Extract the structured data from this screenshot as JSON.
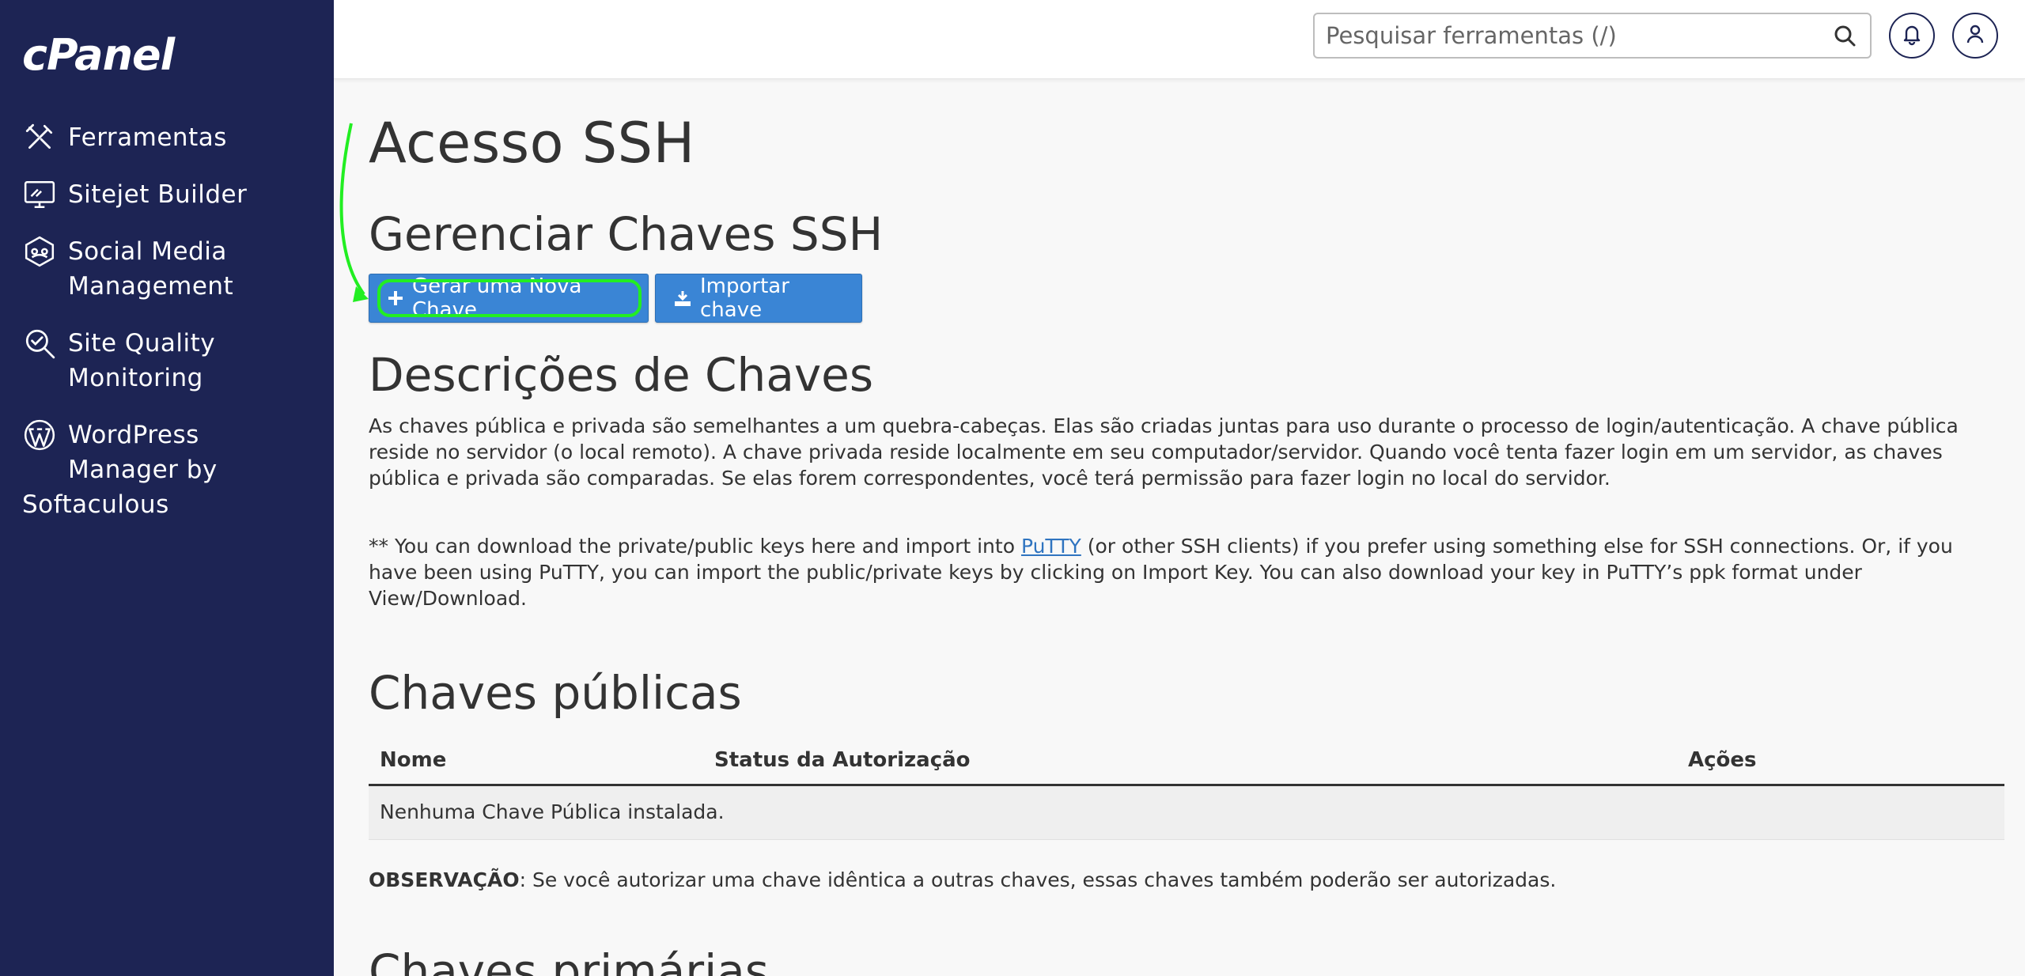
{
  "sidebar": {
    "logo": "cPanel",
    "items": [
      {
        "label": "Ferramentas"
      },
      {
        "label": "Sitejet Builder"
      },
      {
        "label": "Social Media\nManagement"
      },
      {
        "label": "Site Quality\nMonitoring"
      },
      {
        "label": "WordPress\nManager by"
      },
      {
        "label": "Softaculous"
      }
    ]
  },
  "header": {
    "search_placeholder": "Pesquisar ferramentas (/)"
  },
  "main": {
    "title": "Acesso SSH",
    "manage_heading": "Gerenciar Chaves SSH",
    "generate_button": "Gerar uma Nova Chave",
    "import_button": "Importar chave",
    "descriptions_heading": "Descrições de Chaves",
    "description_p1": "As chaves pública e privada são semelhantes a um quebra-cabeças. Elas são criadas juntas para uso durante o processo de login/autenticação. A chave pública reside no servidor (o local remoto). A chave privada reside localmente em seu computador/servidor. Quando você tenta fazer login em um servidor, as chaves pública e privada são comparadas. Se elas forem correspondentes, você terá permissão para fazer login no local do servidor.",
    "description_p2_before": "** You can download the private/public keys here and import into ",
    "description_p2_link": "PuTTY",
    "description_p2_after": " (or other SSH clients) if you prefer using something else for SSH connections. Or, if you have been using PuTTY, you can import the public/private keys by clicking on Import Key. You can also download your key in PuTTY’s ppk format under View/Download.",
    "public_keys_heading": "Chaves públicas",
    "table": {
      "columns": [
        "Nome",
        "Status da Autorização",
        "Ações"
      ],
      "empty_message": "Nenhuma Chave Pública instalada."
    },
    "note_label": "OBSERVAÇÃO",
    "note_text": ": Se você autorizar uma chave idêntica a outras chaves, essas chaves também poderão ser autorizadas.",
    "private_keys_heading": "Chaves primárias"
  },
  "colors": {
    "sidebar_bg": "#1d2454",
    "button_blue": "#3a85d5",
    "highlight_green": "#22ee22"
  }
}
